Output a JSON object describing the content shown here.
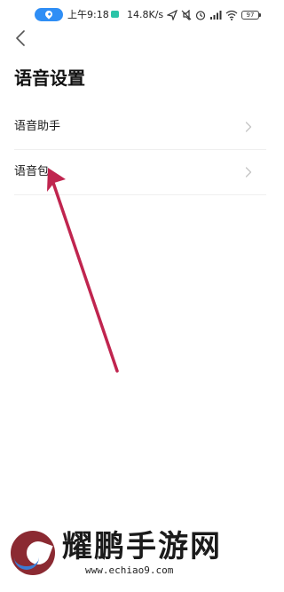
{
  "status_bar": {
    "time": "上午9:18",
    "network_speed": "14.8K/s",
    "battery": "97",
    "icons": [
      "location-icon",
      "chat-notification-icon",
      "send-icon",
      "mute-icon",
      "alarm-icon",
      "signal-icon",
      "wifi-icon",
      "battery-icon"
    ]
  },
  "header": {
    "back_icon": "chevron-left-icon",
    "title": "语音设置"
  },
  "settings": {
    "items": [
      {
        "label": "语音助手",
        "icon": "chevron-right-icon"
      },
      {
        "label": "语音包",
        "icon": "chevron-right-icon"
      }
    ]
  },
  "annotation": {
    "color": "#c0254f",
    "target": "语音包"
  },
  "watermark": {
    "text": "耀鹏手游网",
    "url": "www.echiao9.com"
  }
}
